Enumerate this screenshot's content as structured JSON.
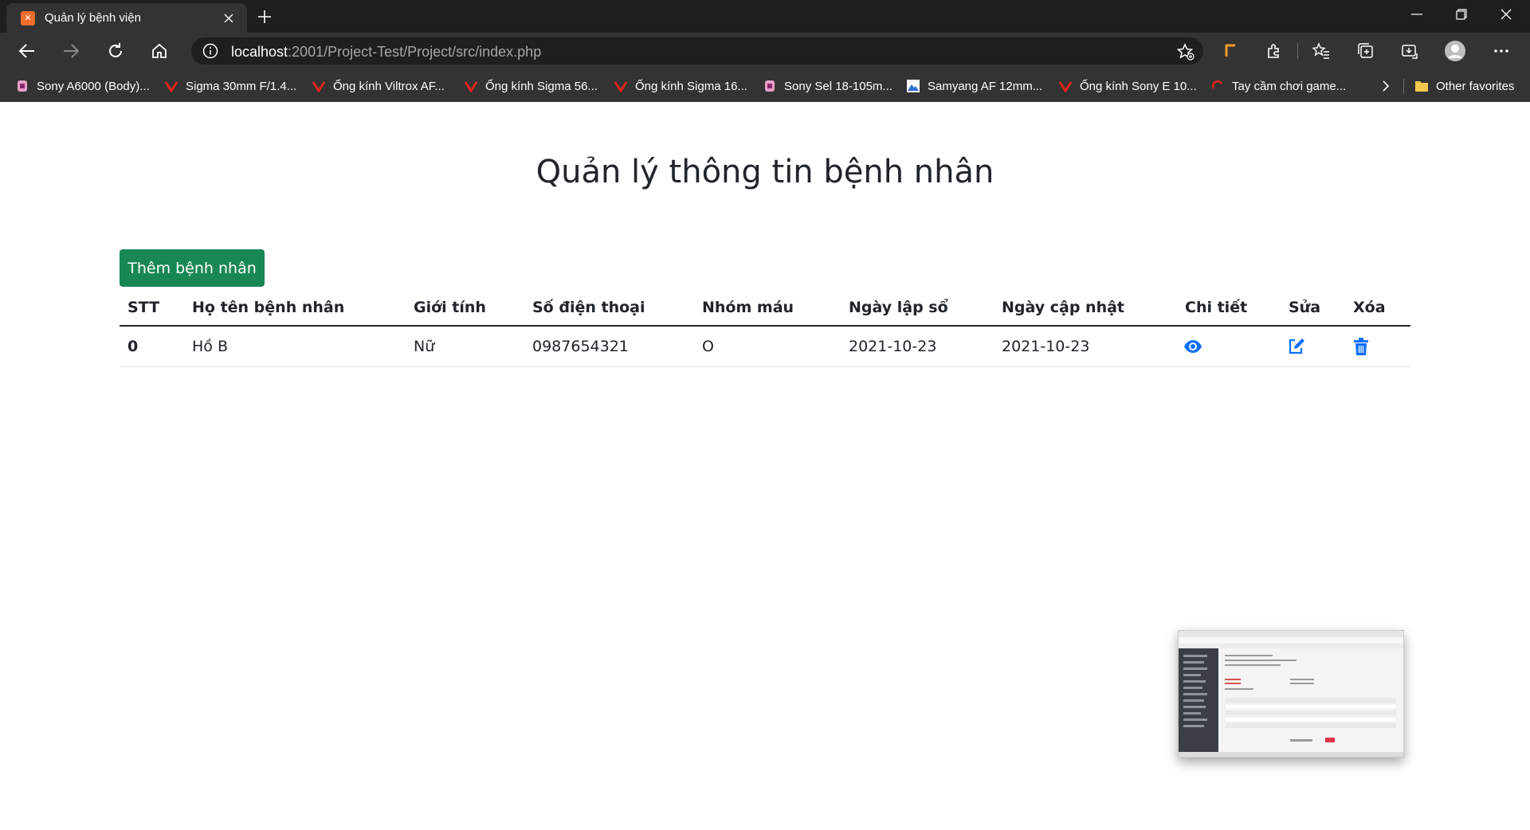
{
  "browser": {
    "tab_title": "Quản lý bệnh viện",
    "url_host": "localhost",
    "url_path": ":2001/Project-Test/Project/src/index.php",
    "favorites": [
      {
        "label": "Sony A6000 (Body)...",
        "icon": "shop-icon"
      },
      {
        "label": "Sigma 30mm F/1.4...",
        "icon": "v-logo-icon"
      },
      {
        "label": "Ống kính Viltrox AF...",
        "icon": "v-logo-icon"
      },
      {
        "label": "Ống kính Sigma 56...",
        "icon": "v-logo-icon"
      },
      {
        "label": "Ống kính Sigma 16...",
        "icon": "v-logo-icon"
      },
      {
        "label": "Sony Sel 18-105m...",
        "icon": "shop-icon"
      },
      {
        "label": "Samyang AF 12mm...",
        "icon": "image-icon"
      },
      {
        "label": "Ống kính Sony E 10...",
        "icon": "v-logo-icon"
      },
      {
        "label": "Tay cầm chơi game...",
        "icon": "gamepad-icon"
      }
    ],
    "other_favorites": "Other favorites"
  },
  "page": {
    "title": "Quản lý thông tin bệnh nhân",
    "add_button": "Thêm bệnh nhân"
  },
  "table": {
    "headers": {
      "stt": "STT",
      "name": "Họ tên bệnh nhân",
      "gender": "Giới tính",
      "phone": "Số điện thoại",
      "blood": "Nhóm máu",
      "created": "Ngày lập sổ",
      "updated": "Ngày cập nhật",
      "detail": "Chi tiết",
      "edit": "Sửa",
      "delete": "Xóa"
    },
    "rows": [
      {
        "stt": "0",
        "name": "Hồ B",
        "gender": "Nữ",
        "phone": "0987654321",
        "blood": "O",
        "created": "2021-10-23",
        "updated": "2021-10-23",
        "detail_icon": "eye-icon",
        "edit_icon": "edit-icon",
        "delete_icon": "trash-icon"
      }
    ]
  },
  "colors": {
    "primary": "#0d6efd",
    "success": "#198754",
    "text": "#212529",
    "chrome_dark": "#1f1f1f",
    "chrome_toolbar": "#333333"
  }
}
